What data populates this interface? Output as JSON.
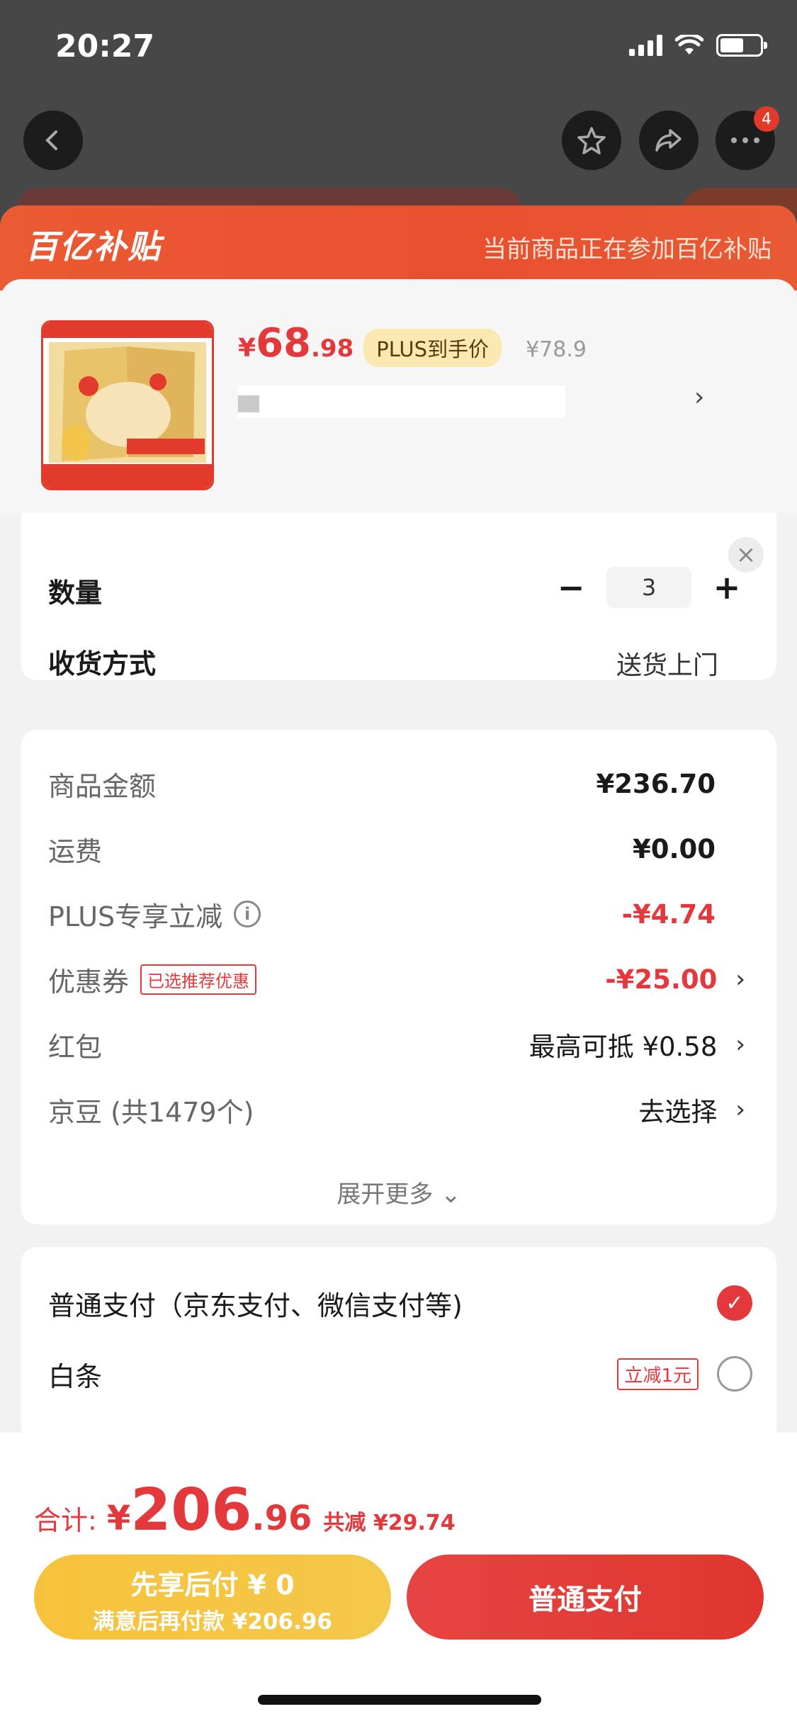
{
  "status_bar": {
    "time": "20:27"
  },
  "nav": {
    "more_badge": "4"
  },
  "header": {
    "brand": "百亿补贴",
    "note": "当前商品正在参加百亿补贴"
  },
  "product": {
    "price_currency": "¥",
    "price_int": "68",
    "price_dec": ".98",
    "plus_badge": "PLUS到手价",
    "original_price": "¥78.9",
    "name_chevron": "›",
    "close": "×"
  },
  "quantity": {
    "label": "数量",
    "minus": "−",
    "value": "3",
    "plus": "+"
  },
  "delivery": {
    "label": "收货方式",
    "value": "送货上门"
  },
  "amounts": {
    "goods": {
      "label": "商品金额",
      "value": "¥236.70"
    },
    "shipping": {
      "label": "运费",
      "value": "¥0.00"
    },
    "plus_discount": {
      "label": "PLUS专享立减",
      "value": "-¥4.74",
      "info": "i"
    },
    "coupon": {
      "label": "优惠券",
      "tag": "已选推荐优惠",
      "value": "-¥25.00",
      "chev": "›"
    },
    "red_packet": {
      "label": "红包",
      "value": "最高可抵 ¥0.58",
      "chev": "›"
    },
    "jingdou": {
      "label": "京豆 (共1479个)",
      "value": "去选择",
      "chev": "›"
    },
    "expand": "展开更多 ⌄"
  },
  "payment": {
    "normal": {
      "label": "普通支付（京东支付、微信支付等)",
      "checked": "✓"
    },
    "baitiao": {
      "label": "白条",
      "tag": "立减1元"
    }
  },
  "total": {
    "label": "合计:",
    "currency": "¥",
    "int": "206",
    "dec": ".96",
    "saved": "共减 ¥29.74"
  },
  "buttons": {
    "pay_later_line1": "先享后付 ¥ 0",
    "pay_later_line2": "满意后再付款 ¥206.96",
    "pay_normal": "普通支付"
  },
  "colors": {
    "accent_red": "#e4393c",
    "brand_orange": "#e8502e",
    "gold": "#f7c23b"
  }
}
